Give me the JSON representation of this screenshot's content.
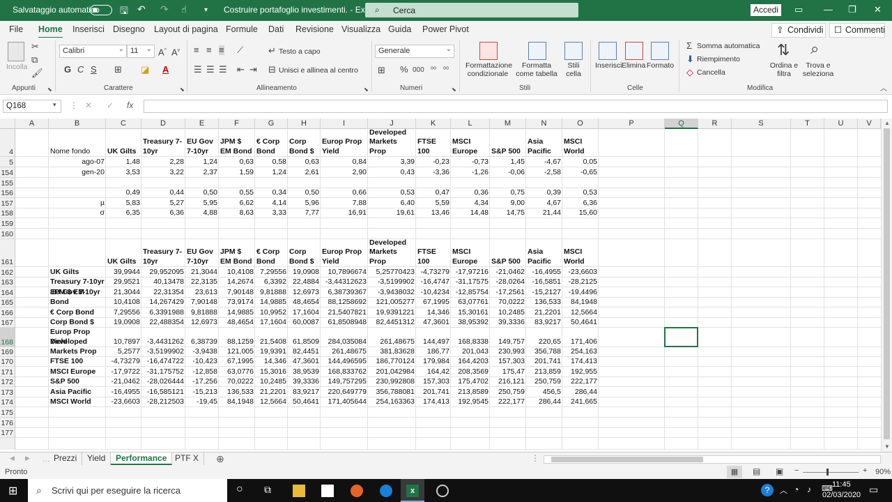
{
  "titlebar": {
    "autosave_label": "Salvataggio automatico",
    "doc_title": "Costruire portafoglio investimenti.  -  Excel",
    "search_placeholder": "Cerca",
    "signin_label": "Accedi"
  },
  "tabs": [
    "File",
    "Home",
    "Inserisci",
    "Disegno",
    "Layout di pagina",
    "Formule",
    "Dati",
    "Revisione",
    "Visualizza",
    "Guida",
    "Power Pivot"
  ],
  "active_tab": "Home",
  "share_label": "Condividi",
  "comments_label": "Commenti",
  "ribbon": {
    "clipboard": {
      "paste_label": "Incolla",
      "group_label": "Appunti"
    },
    "font": {
      "font_name": "Calibri",
      "font_size": "11",
      "bold": "G",
      "italic": "C",
      "underline": "S",
      "group_label": "Carattere"
    },
    "alignment": {
      "wrap_label": "Testo a capo",
      "merge_label": "Unisci e allinea al centro",
      "group_label": "Allineamento"
    },
    "number": {
      "format": "Generale",
      "group_label": "Numeri"
    },
    "styles": {
      "conditional_label": "Formattazione condizionale",
      "table_label": "Formatta come tabella",
      "cell_styles_label": "Stili cella",
      "group_label": "Stili"
    },
    "cells": {
      "insert_label": "Inserisci",
      "delete_label": "Elimina",
      "format_label": "Formato",
      "group_label": "Celle"
    },
    "editing": {
      "autosum_label": "Somma automatica",
      "fill_label": "Riempimento",
      "clear_label": "Cancella",
      "sort_label": "Ordina e filtra",
      "find_label": "Trova e seleziona",
      "group_label": "Modifica"
    }
  },
  "formula_bar": {
    "name_box": "Q168",
    "fx": "fx",
    "content": ""
  },
  "columns": [
    "A",
    "B",
    "C",
    "D",
    "E",
    "F",
    "G",
    "H",
    "I",
    "J",
    "K",
    "L",
    "M",
    "N",
    "O",
    "P",
    "Q",
    "R",
    "S",
    "T",
    "U",
    "V"
  ],
  "selected_column": "Q",
  "selected_row": "168",
  "row_numbers": [
    "4",
    "5",
    "154",
    "155",
    "156",
    "157",
    "158",
    "159",
    "160",
    "161",
    "162",
    "163",
    "164",
    "165",
    "166",
    "167",
    "168",
    "169",
    "170",
    "171",
    "172",
    "173",
    "174",
    "175",
    "176",
    "177"
  ],
  "headers_top": [
    "Nome fondo",
    "UK Gilts",
    "Treasury 7-10yr",
    "EU Gov 7-10yr",
    "JPM $ EM Bond",
    "€ Corp Bond",
    "Corp Bond $",
    "Europ Prop Yield",
    "Developed Markets Prop",
    "FTSE 100",
    "MSCI Europe",
    "S&P 500",
    "Asia Pacific",
    "MSCI World"
  ],
  "row5": {
    "label": "ago-07",
    "values": [
      "1,48",
      "2,28",
      "1,24",
      "0,63",
      "0,58",
      "0,63",
      "0,84",
      "3,39",
      "-0,23",
      "-0,73",
      "1,45",
      "-4,67",
      "0,05"
    ]
  },
  "row154": {
    "label": "gen-20",
    "values": [
      "3,53",
      "3,22",
      "2,37",
      "1,59",
      "1,24",
      "2,61",
      "2,90",
      "0,43",
      "-3,36",
      "-1,26",
      "-0,06",
      "-2,58",
      "-0,65"
    ]
  },
  "row156": {
    "label": "",
    "values": [
      "0,49",
      "0,44",
      "0,50",
      "0,55",
      "0,34",
      "0,50",
      "0,66",
      "0,53",
      "0,47",
      "0,36",
      "0,75",
      "0,39",
      "0,53"
    ]
  },
  "row157": {
    "label": "µ",
    "values": [
      "5,83",
      "5,27",
      "5,95",
      "6,62",
      "4,14",
      "5,96",
      "7,88",
      "6,40",
      "5,59",
      "4,34",
      "9,00",
      "4,67",
      "6,36"
    ]
  },
  "row158": {
    "label": "σ",
    "values": [
      "6,35",
      "6,36",
      "4,88",
      "8,63",
      "3,33",
      "7,77",
      "16,91",
      "19,61",
      "13,46",
      "14,48",
      "14,75",
      "21,44",
      "15,60"
    ]
  },
  "matrix_headers": [
    "UK Gilts",
    "Treasury 7-10yr",
    "EU Gov 7-10yr",
    "JPM $ EM Bond",
    "€ Corp Bond",
    "Corp Bond $",
    "Europ Prop Yield",
    "Developed Markets Prop",
    "FTSE 100",
    "MSCI Europe",
    "S&P 500",
    "Asia Pacific",
    "MSCI World"
  ],
  "matrix": [
    {
      "label": "UK Gilts",
      "values": [
        "39,9944",
        "29,952095",
        "21,3044",
        "10,4108",
        "7,29556",
        "19,0908",
        "10,7896674",
        "5,25770423",
        "-4,73279",
        "-17,97216",
        "-21,0462",
        "-16,4955",
        "-23,6603"
      ]
    },
    {
      "label": "Treasury 7-10yr",
      "values": [
        "29,9521",
        "40,13478",
        "22,3135",
        "14,2674",
        "6,3392",
        "22,4884",
        "-3,44312623",
        "-3,5199902",
        "-16,4747",
        "-31,17575",
        "-28,0264",
        "-16,5851",
        "-28,2125"
      ]
    },
    {
      "label": "EU Gov 7-10yr",
      "values": [
        "21,3044",
        "22,31354",
        "23,613",
        "7,90148",
        "9,81888",
        "12,6973",
        "6,38739367",
        "-3,9438032",
        "-10,4234",
        "-12,85754",
        "-17,2561",
        "-15,2127",
        "-19,4496"
      ]
    },
    {
      "label": "JPM $ EM Bond",
      "values": [
        "10,4108",
        "14,267429",
        "7,90148",
        "73,9174",
        "14,9885",
        "48,4654",
        "88,1258692",
        "121,005277",
        "67,1995",
        "63,07761",
        "70,0222",
        "136,533",
        "84,1948"
      ]
    },
    {
      "label": "€ Corp Bond",
      "values": [
        "7,29556",
        "6,3391988",
        "9,81888",
        "14,9885",
        "10,9952",
        "17,1604",
        "21,5407821",
        "19,9391221",
        "14,346",
        "15,30161",
        "10,2485",
        "21,2201",
        "12,5664"
      ]
    },
    {
      "label": "Corp Bond $",
      "values": [
        "19,0908",
        "22,488354",
        "12,6973",
        "48,4654",
        "17,1604",
        "60,0087",
        "61,8508948",
        "82,4451312",
        "47,3601",
        "38,95392",
        "39,3336",
        "83,9217",
        "50,4641"
      ]
    },
    {
      "label": "Europ Prop Yield",
      "values": [
        "10,7897",
        "-3,4431262",
        "6,38739",
        "88,1259",
        "21,5408",
        "61,8509",
        "284,035084",
        "261,48675",
        "144,497",
        "168,8338",
        "149,757",
        "220,65",
        "171,406"
      ]
    },
    {
      "label": "Developed Markets Prop",
      "values": [
        "5,2577",
        "-3,5199902",
        "-3,9438",
        "121,005",
        "19,9391",
        "82,4451",
        "261,48675",
        "381,83628",
        "186,77",
        "201,043",
        "230,993",
        "356,788",
        "254,163"
      ]
    },
    {
      "label": "FTSE 100",
      "values": [
        "-4,73279",
        "-16,474722",
        "-10,423",
        "67,1995",
        "14,346",
        "47,3601",
        "144,496595",
        "186,770124",
        "179,984",
        "164,4203",
        "157,303",
        "201,741",
        "174,413"
      ]
    },
    {
      "label": "MSCI Europe",
      "values": [
        "-17,9722",
        "-31,175752",
        "-12,858",
        "63,0776",
        "15,3016",
        "38,9539",
        "168,833762",
        "201,042984",
        "164,42",
        "208,3569",
        "175,47",
        "213,859",
        "192,955"
      ]
    },
    {
      "label": "S&P 500",
      "values": [
        "-21,0462",
        "-28,026444",
        "-17,256",
        "70,0222",
        "10,2485",
        "39,3336",
        "149,757295",
        "230,992808",
        "157,303",
        "175,4702",
        "216,121",
        "250,759",
        "222,177"
      ]
    },
    {
      "label": "Asia Pacific",
      "values": [
        "-16,4955",
        "-16,585121",
        "-15,213",
        "136,533",
        "21,2201",
        "83,9217",
        "220,649779",
        "356,788081",
        "201,741",
        "213,8589",
        "250,759",
        "456,5",
        "286,44"
      ]
    },
    {
      "label": "MSCI World",
      "values": [
        "-23,6603",
        "-28,212503",
        "-19,45",
        "84,1948",
        "12,5664",
        "50,4641",
        "171,405644",
        "254,163363",
        "174,413",
        "192,9545",
        "222,177",
        "286,44",
        "241,665"
      ]
    }
  ],
  "sheets": [
    "Prezzi",
    "Yield",
    "Performance",
    "PTF X"
  ],
  "active_sheet": "Performance",
  "status": {
    "ready": "Pronto",
    "zoom": "90%"
  },
  "taskbar": {
    "search_placeholder": "Scrivi qui per eseguire la ricerca",
    "time": "11:45",
    "date": "02/03/2020"
  },
  "colors": {
    "excel_green": "#217346",
    "taskbar": "#101010"
  }
}
